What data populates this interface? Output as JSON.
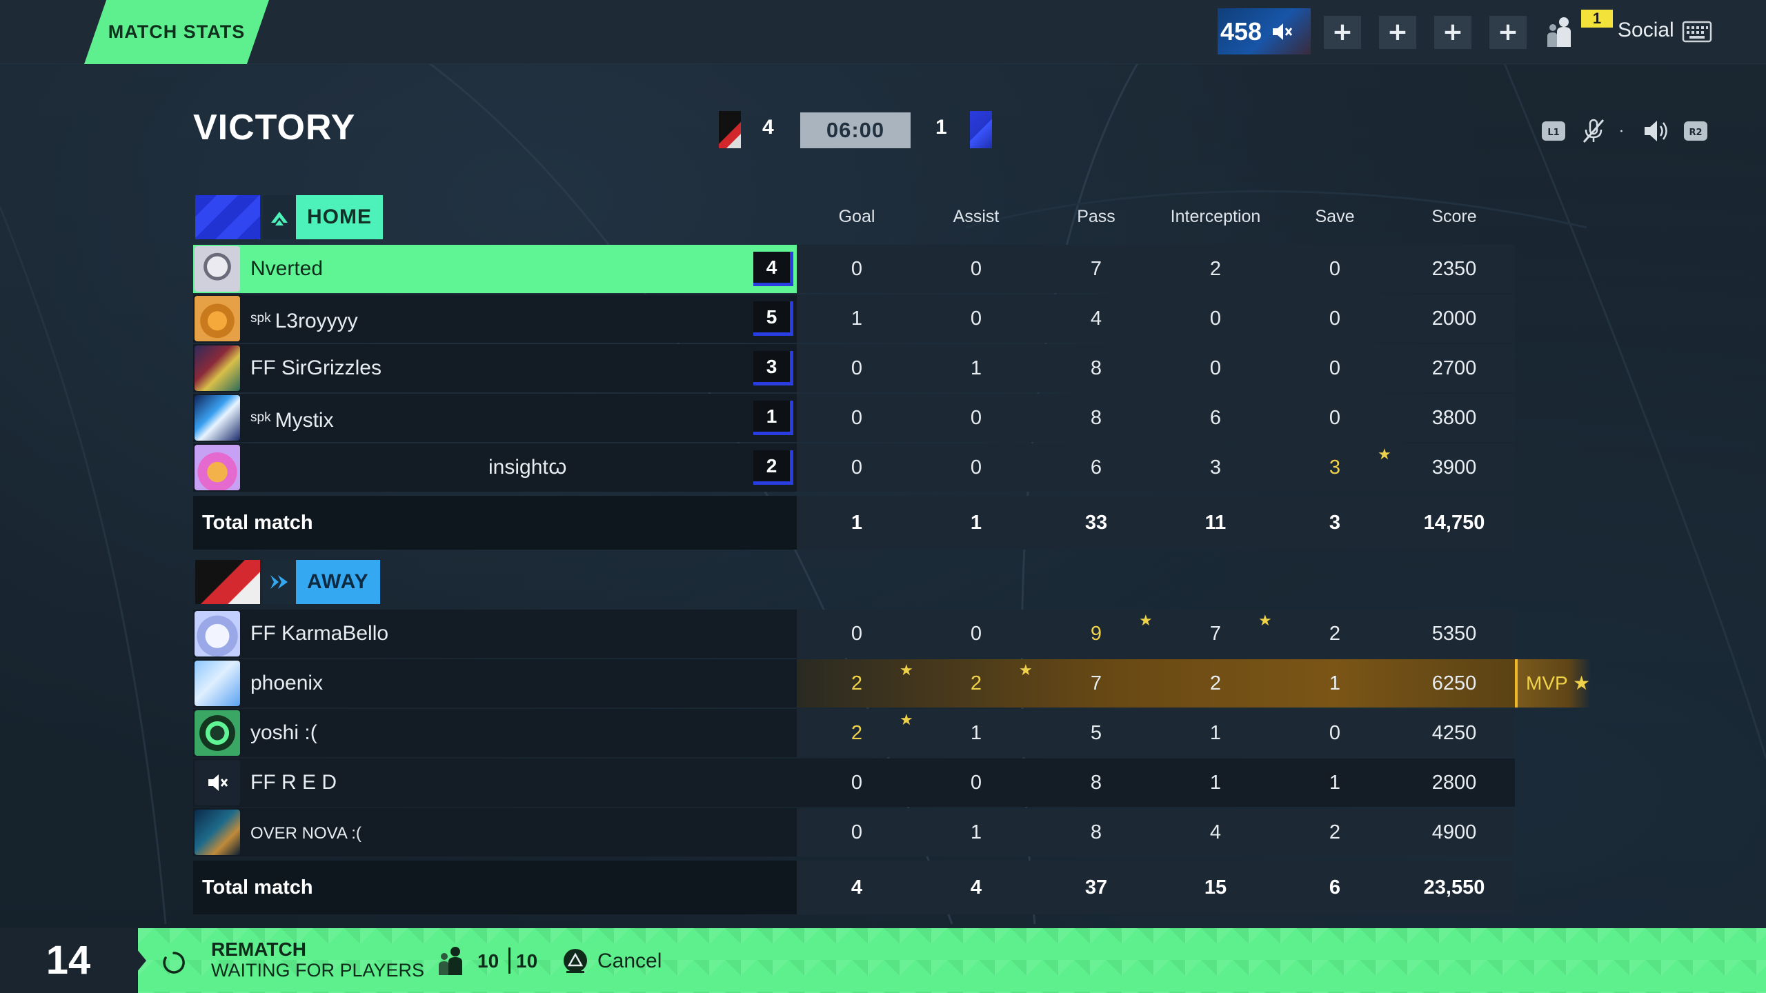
{
  "top_bar": {
    "tab_label": "MATCH STATS",
    "currency": "458",
    "social_badge": "1",
    "social_label": "Social",
    "plus_buttons": [
      "+",
      "+",
      "+",
      "+"
    ]
  },
  "match": {
    "result": "VICTORY",
    "home_score": "4",
    "away_score": "1",
    "timer": "06:00"
  },
  "columns": [
    "Goal",
    "Assist",
    "Pass",
    "Interception",
    "Save",
    "Score"
  ],
  "home": {
    "label": "HOME",
    "players": [
      {
        "name": "Nverted",
        "tag": "",
        "rank": "4",
        "stats": [
          "0",
          "0",
          "7",
          "2",
          "0",
          "2350"
        ],
        "gold": [],
        "stars": [],
        "highlight": true
      },
      {
        "name": "L3royyyy",
        "tag": "spk",
        "rank": "5",
        "stats": [
          "1",
          "0",
          "4",
          "0",
          "0",
          "2000"
        ],
        "gold": [],
        "stars": []
      },
      {
        "name": "FF SirGrizzles",
        "tag": "",
        "rank": "3",
        "stats": [
          "0",
          "1",
          "8",
          "0",
          "0",
          "2700"
        ],
        "gold": [],
        "stars": []
      },
      {
        "name": "Mystix",
        "tag": "spk",
        "rank": "1",
        "stats": [
          "0",
          "0",
          "8",
          "6",
          "0",
          "3800"
        ],
        "gold": [],
        "stars": []
      },
      {
        "name": "insightꞷ",
        "tag": "",
        "rank": "2",
        "stats": [
          "0",
          "0",
          "6",
          "3",
          "3",
          "3900"
        ],
        "gold": [
          4
        ],
        "stars": [
          4
        ],
        "centered_name": true
      }
    ],
    "total_label": "Total match",
    "totals": [
      "1",
      "1",
      "33",
      "11",
      "3",
      "14,750"
    ]
  },
  "away": {
    "label": "AWAY",
    "players": [
      {
        "name": "FF KarmaBello",
        "tag": "",
        "stats": [
          "0",
          "0",
          "9",
          "7",
          "2",
          "5350"
        ],
        "gold": [
          2
        ],
        "stars": [
          2,
          3
        ]
      },
      {
        "name": "phoenix",
        "tag": "",
        "stats": [
          "2",
          "2",
          "7",
          "2",
          "1",
          "6250"
        ],
        "gold": [
          0,
          1
        ],
        "stars": [
          0,
          1
        ],
        "mvp": true
      },
      {
        "name": "yoshi :(",
        "tag": "",
        "stats": [
          "2",
          "1",
          "5",
          "1",
          "0",
          "4250"
        ],
        "gold": [
          0
        ],
        "stars": [
          0
        ]
      },
      {
        "name": "FF R E D",
        "tag": "",
        "stats": [
          "0",
          "0",
          "8",
          "1",
          "1",
          "2800"
        ],
        "gold": [],
        "stars": [],
        "selected": true,
        "muted": true
      },
      {
        "name": "OVER NOVA :(",
        "tag": "",
        "stats": [
          "0",
          "1",
          "8",
          "4",
          "2",
          "4900"
        ],
        "gold": [],
        "stars": [],
        "smallcaps": true
      }
    ],
    "total_label": "Total match",
    "totals": [
      "4",
      "4",
      "37",
      "15",
      "6",
      "23,550"
    ]
  },
  "mvp_label": "MVP ★",
  "bottom_bar": {
    "countdown": "14",
    "rematch_title": "REMATCH",
    "rematch_sub": "WAITING FOR PLAYERS",
    "players_ready": "10",
    "players_total": "10",
    "cancel_label": "Cancel"
  },
  "colors": {
    "accent_green": "#5ef08f",
    "home_label": "#4cf2b9",
    "away_label": "#35a8f2",
    "gold": "#f0d24a"
  },
  "icons": [
    "mute-icon",
    "social-icon",
    "keyboard-icon",
    "lb-icon",
    "mic-off-icon",
    "volume-icon",
    "rb-icon",
    "spinner-icon",
    "players-icon",
    "cancel-button-icon"
  ]
}
